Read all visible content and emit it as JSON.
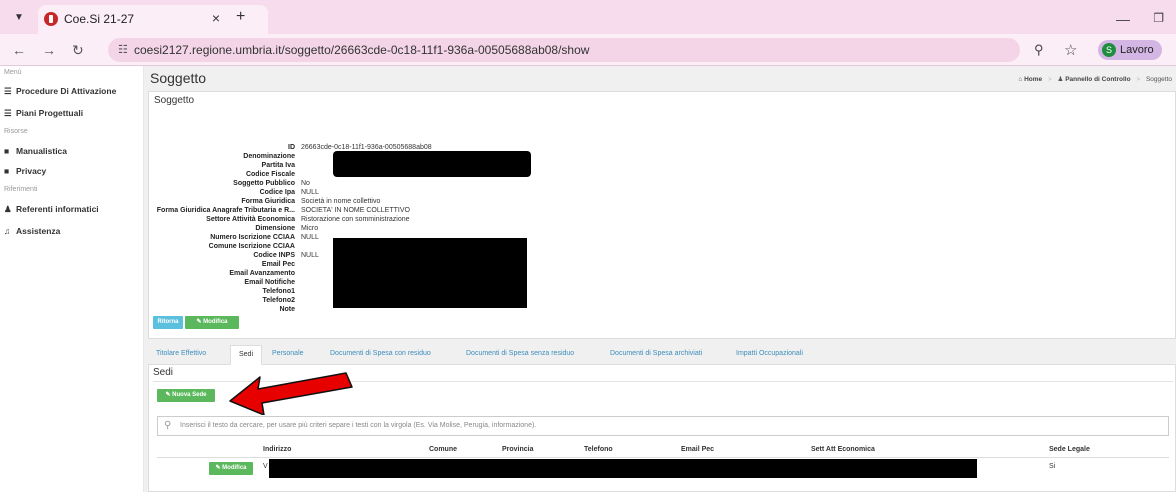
{
  "browser": {
    "tab_title": "Coe.Si 21-27",
    "close": "×",
    "new_tab": "+",
    "url": "coesi2127.regione.umbria.it/soggetto/26663cde-0c18-11f1-936a-00505688ab08/show",
    "profile_initial": "S",
    "profile_label": "Lavoro"
  },
  "sidebar": {
    "sections": [
      {
        "heading": "Menù",
        "items": [
          "Procedure Di Attivazione",
          "Piani Progettuali"
        ]
      },
      {
        "heading": "Risorse",
        "items": [
          "Manualistica",
          "Privacy"
        ]
      },
      {
        "heading": "Riferimenti",
        "items": [
          "Referenti informatici",
          "Assistenza"
        ]
      }
    ]
  },
  "page": {
    "title": "Soggetto",
    "breadcrumb": [
      "Home",
      "Pannello di Controllo",
      "Soggetto"
    ]
  },
  "soggetto": {
    "panel_title": "Soggetto",
    "fields": [
      {
        "label": "ID",
        "value": "26663cde-0c18-11f1-936a-00505688ab08"
      },
      {
        "label": "Denominazione",
        "value": ""
      },
      {
        "label": "Partita Iva",
        "value": ""
      },
      {
        "label": "Codice Fiscale",
        "value": ""
      },
      {
        "label": "Soggetto Pubblico",
        "value": "No"
      },
      {
        "label": "Codice Ipa",
        "value": "NULL"
      },
      {
        "label": "Forma Giuridica",
        "value": "Società in nome collettivo"
      },
      {
        "label": "Forma Giuridica Anagrafe Tributaria e R...",
        "value": "SOCIETA' IN NOME COLLETTIVO"
      },
      {
        "label": "Settore Attività Economica",
        "value": "Ristorazione con somministrazione"
      },
      {
        "label": "Dimensione",
        "value": "Micro"
      },
      {
        "label": "Numero Iscrizione CCIAA",
        "value": "NULL"
      },
      {
        "label": "Comune Iscrizione CCIAA",
        "value": ""
      },
      {
        "label": "Codice INPS",
        "value": "NULL"
      },
      {
        "label": "Email Pec",
        "value": ""
      },
      {
        "label": "Email Avanzamento",
        "value": ""
      },
      {
        "label": "Email Notifiche",
        "value": ""
      },
      {
        "label": "Telefono1",
        "value": ""
      },
      {
        "label": "Telefono2",
        "value": ""
      },
      {
        "label": "Note",
        "value": ""
      }
    ],
    "btn_back": "Ritorna",
    "btn_edit": "Modifica"
  },
  "tabs": [
    "Titolare Effettivo",
    "Sedi",
    "Personale",
    "Documenti di Spesa con residuo",
    "Documenti di Spesa senza residuo",
    "Documenti di Spesa archiviati",
    "Impatti Occupazionali"
  ],
  "sedi": {
    "title": "Sedi",
    "new_button": "Nuova Sede",
    "search_placeholder": "Inserisci il testo da cercare, per usare più criteri separe i testi con la virgola (Es. Via Molise, Perugia, informazione).",
    "columns": [
      "Indirizzo",
      "Comune",
      "Provincia",
      "Telefono",
      "Email Pec",
      "Sett Att Economica",
      "Sede Legale"
    ],
    "rows": [
      {
        "edit": "Modifica",
        "indirizzo": "V",
        "sede_legale": "Si"
      }
    ]
  },
  "colors": {
    "accent_link": "#3c8dbc",
    "btn_info": "#5bc0de",
    "btn_success": "#5cb85c",
    "annotation_arrow": "#e60000"
  }
}
